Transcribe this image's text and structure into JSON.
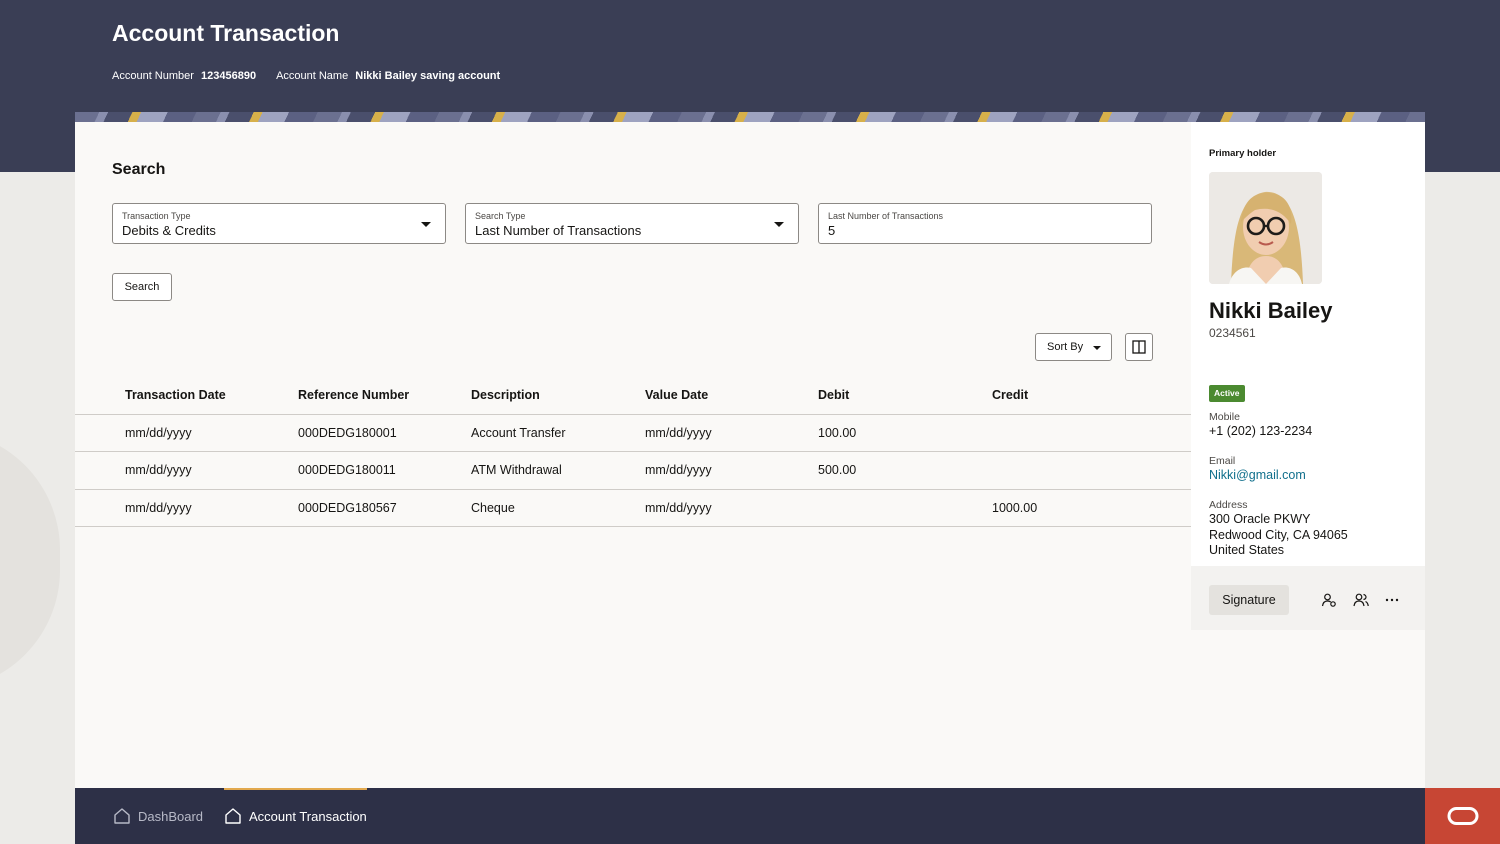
{
  "header": {
    "title": "Account Transaction",
    "account_number_label": "Account Number",
    "account_number": "123456890",
    "account_name_label": "Account Name",
    "account_name": "Nikki Bailey saving account"
  },
  "search": {
    "heading": "Search",
    "transaction_type": {
      "label": "Transaction Type",
      "value": "Debits & Credits"
    },
    "search_type": {
      "label": "Search Type",
      "value": "Last Number of Transactions"
    },
    "last_number": {
      "label": "Last Number of Transactions",
      "value": "5"
    },
    "button": "Search"
  },
  "toolbar": {
    "sort_label": "Sort By",
    "columns_icon": "columns-icon"
  },
  "table": {
    "columns": [
      "Transaction Date",
      "Reference Number",
      "Description",
      "Value Date",
      "Debit",
      "Credit"
    ],
    "rows": [
      [
        "mm/dd/yyyy",
        "000DEDG180001",
        "Account Transfer",
        "mm/dd/yyyy",
        "100.00",
        ""
      ],
      [
        "mm/dd/yyyy",
        "000DEDG180011",
        "ATM Withdrawal",
        "mm/dd/yyyy",
        "500.00",
        ""
      ],
      [
        "mm/dd/yyyy",
        "000DEDG180567",
        "Cheque",
        "mm/dd/yyyy",
        "",
        "1000.00"
      ]
    ]
  },
  "holder": {
    "section_label": "Primary holder",
    "name": "Nikki Bailey",
    "id": "0234561",
    "status": "Active",
    "mobile_label": "Mobile",
    "mobile": "+1 (202) 123-2234",
    "email_label": "Email",
    "email": "Nikki@gmail.com",
    "address_label": "Address",
    "address_lines": [
      "300 Oracle PKWY",
      "Redwood City, CA 94065",
      "United States"
    ],
    "signature_button": "Signature",
    "action_icons": [
      "user-settings-icon",
      "users-icon",
      "more-icon"
    ]
  },
  "bottom_nav": {
    "items": [
      {
        "label": "DashBoard",
        "icon": "home-icon",
        "active": false
      },
      {
        "label": "Account Transaction",
        "icon": "home-icon",
        "active": true
      }
    ]
  },
  "colors": {
    "header_bg": "#3a3e55",
    "bottom_bar_bg": "#2d3047",
    "active_tab_accent": "#e2a94e",
    "status_active": "#4b8a30",
    "link": "#106f8c",
    "brand_red": "#c74634"
  }
}
